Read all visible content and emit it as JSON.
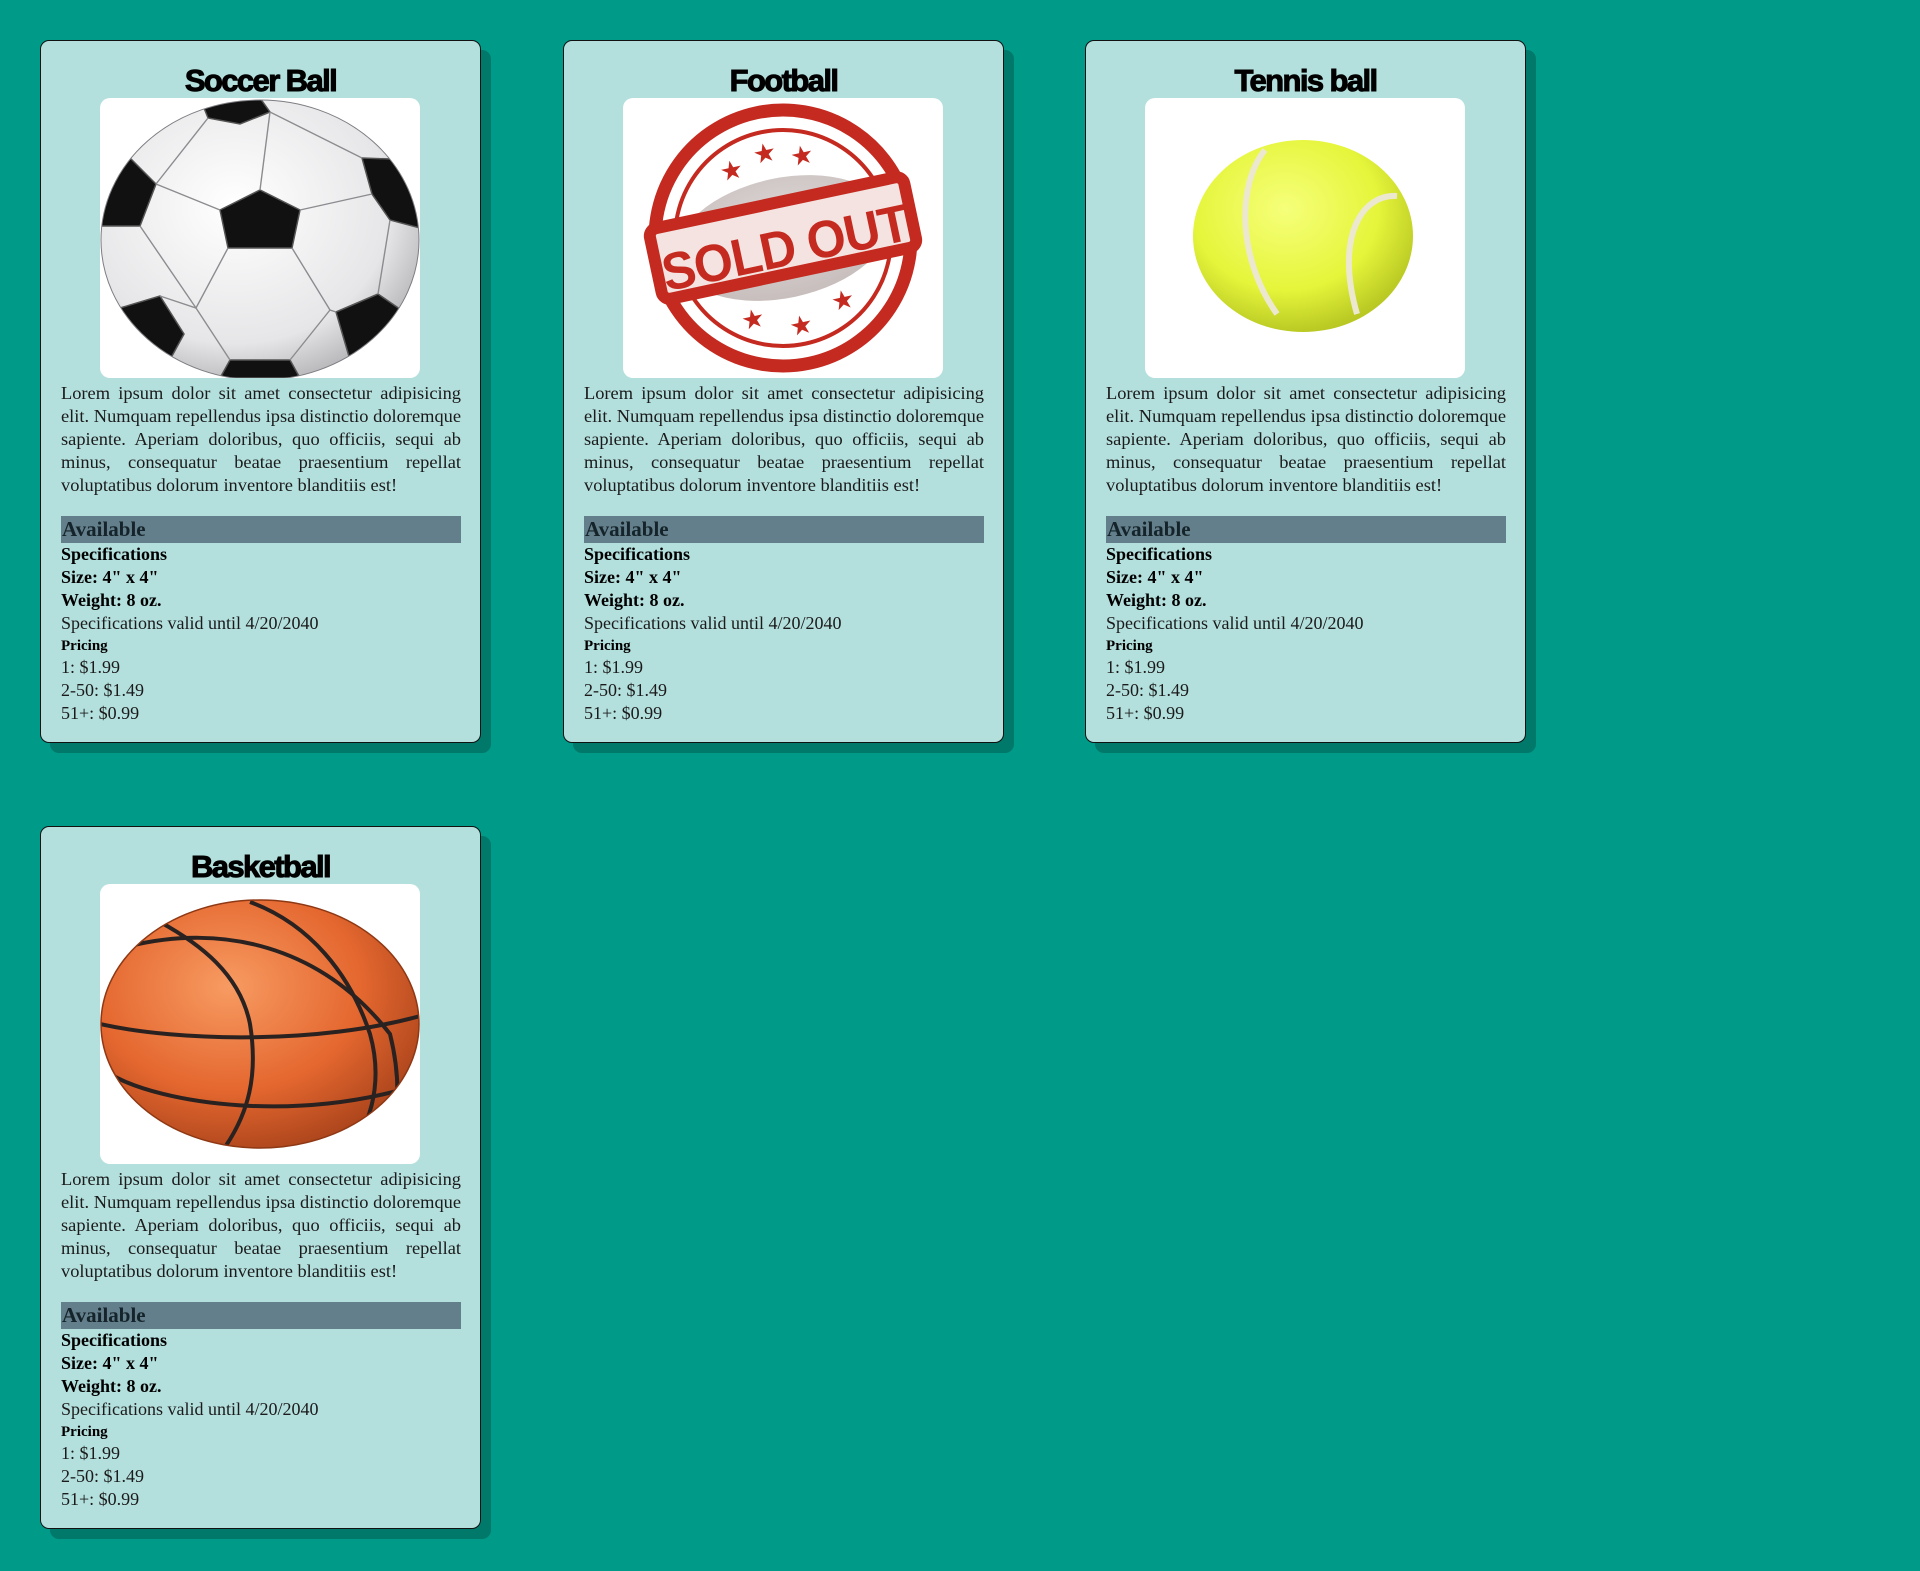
{
  "colors": {
    "page_background": "#009a89",
    "card_background": "#b3dfdd",
    "card_shadow": "#00786a",
    "status_bar": "#637f8b"
  },
  "cards": [
    {
      "title": "Soccer Ball",
      "image": "soccer-ball-image",
      "description": "Lorem ipsum dolor sit amet consectetur adipisicing elit. Numquam repellendus ipsa distinctio doloremque sapiente. Aperiam doloribus, quo officiis, sequi ab minus, consequatur beatae praesentium repellat voluptatibus dolorum inventore blanditiis est!",
      "status": "Available",
      "specs_heading": "Specifications",
      "size": "Size: 4\" x 4\"",
      "weight": "Weight: 8 oz.",
      "valid": "Specifications valid until 4/20/2040",
      "pricing_heading": "Pricing",
      "price_1": "1: $1.99",
      "price_2": "2-50: $1.49",
      "price_3": "51+: $0.99"
    },
    {
      "title": "Football",
      "image": "sold-out-stamp-image",
      "stamp_text": "SOLD OUT",
      "description": "Lorem ipsum dolor sit amet consectetur adipisicing elit. Numquam repellendus ipsa distinctio doloremque sapiente. Aperiam doloribus, quo officiis, sequi ab minus, consequatur beatae praesentium repellat voluptatibus dolorum inventore blanditiis est!",
      "status": "Available",
      "specs_heading": "Specifications",
      "size": "Size: 4\" x 4\"",
      "weight": "Weight: 8 oz.",
      "valid": "Specifications valid until 4/20/2040",
      "pricing_heading": "Pricing",
      "price_1": "1: $1.99",
      "price_2": "2-50: $1.49",
      "price_3": "51+: $0.99"
    },
    {
      "title": "Tennis ball",
      "image": "tennis-ball-image",
      "description": "Lorem ipsum dolor sit amet consectetur adipisicing elit. Numquam repellendus ipsa distinctio doloremque sapiente. Aperiam doloribus, quo officiis, sequi ab minus, consequatur beatae praesentium repellat voluptatibus dolorum inventore blanditiis est!",
      "status": "Available",
      "specs_heading": "Specifications",
      "size": "Size: 4\" x 4\"",
      "weight": "Weight: 8 oz.",
      "valid": "Specifications valid until 4/20/2040",
      "pricing_heading": "Pricing",
      "price_1": "1: $1.99",
      "price_2": "2-50: $1.49",
      "price_3": "51+: $0.99"
    },
    {
      "title": "Basketball",
      "image": "basketball-image",
      "description": "Lorem ipsum dolor sit amet consectetur adipisicing elit. Numquam repellendus ipsa distinctio doloremque sapiente. Aperiam doloribus, quo officiis, sequi ab minus, consequatur beatae praesentium repellat voluptatibus dolorum inventore blanditiis est!",
      "status": "Available",
      "specs_heading": "Specifications",
      "size": "Size: 4\" x 4\"",
      "weight": "Weight: 8 oz.",
      "valid": "Specifications valid until 4/20/2040",
      "pricing_heading": "Pricing",
      "price_1": "1: $1.99",
      "price_2": "2-50: $1.49",
      "price_3": "51+: $0.99"
    }
  ]
}
